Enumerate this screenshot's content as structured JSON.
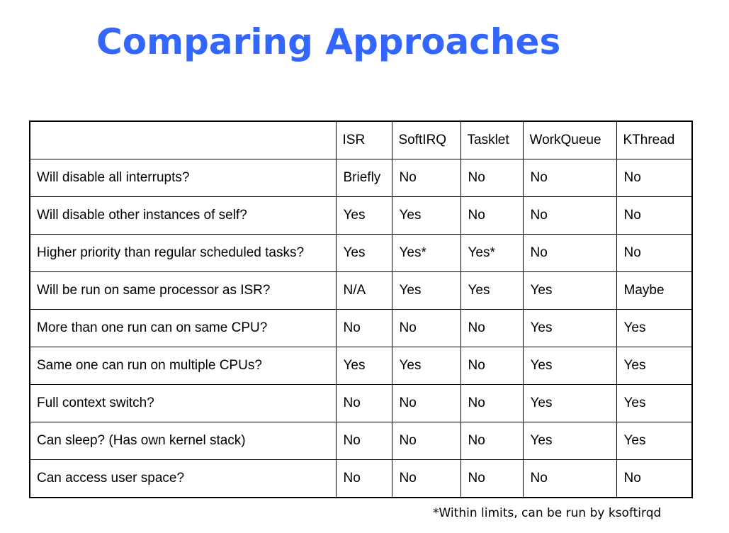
{
  "title": "Comparing Approaches",
  "table": {
    "headers": [
      "",
      "ISR",
      "SoftIRQ",
      "Tasklet",
      "WorkQueue",
      "KThread"
    ],
    "rows": [
      [
        "Will disable all interrupts?",
        "Briefly",
        "No",
        "No",
        "No",
        "No"
      ],
      [
        "Will disable other instances of self?",
        "Yes",
        "Yes",
        "No",
        "No",
        "No"
      ],
      [
        "Higher priority than regular scheduled tasks?",
        "Yes",
        "Yes*",
        "Yes*",
        "No",
        "No"
      ],
      [
        "Will be run on same processor as ISR?",
        "N/A",
        "Yes",
        "Yes",
        "Yes",
        "Maybe"
      ],
      [
        "More than one run can on same CPU?",
        "No",
        "No",
        "No",
        "Yes",
        "Yes"
      ],
      [
        "Same one can run on multiple CPUs?",
        "Yes",
        "Yes",
        "No",
        "Yes",
        "Yes"
      ],
      [
        "Full context switch?",
        "No",
        "No",
        "No",
        "Yes",
        "Yes"
      ],
      [
        "Can sleep? (Has own kernel stack)",
        "No",
        "No",
        "No",
        "Yes",
        "Yes"
      ],
      [
        "Can access user space?",
        "No",
        "No",
        "No",
        "No",
        "No"
      ]
    ]
  },
  "footnote": "*Within limits, can be run by ksoftirqd",
  "colors": {
    "title": "#3366FF",
    "border": "#000000",
    "text": "#000000"
  }
}
